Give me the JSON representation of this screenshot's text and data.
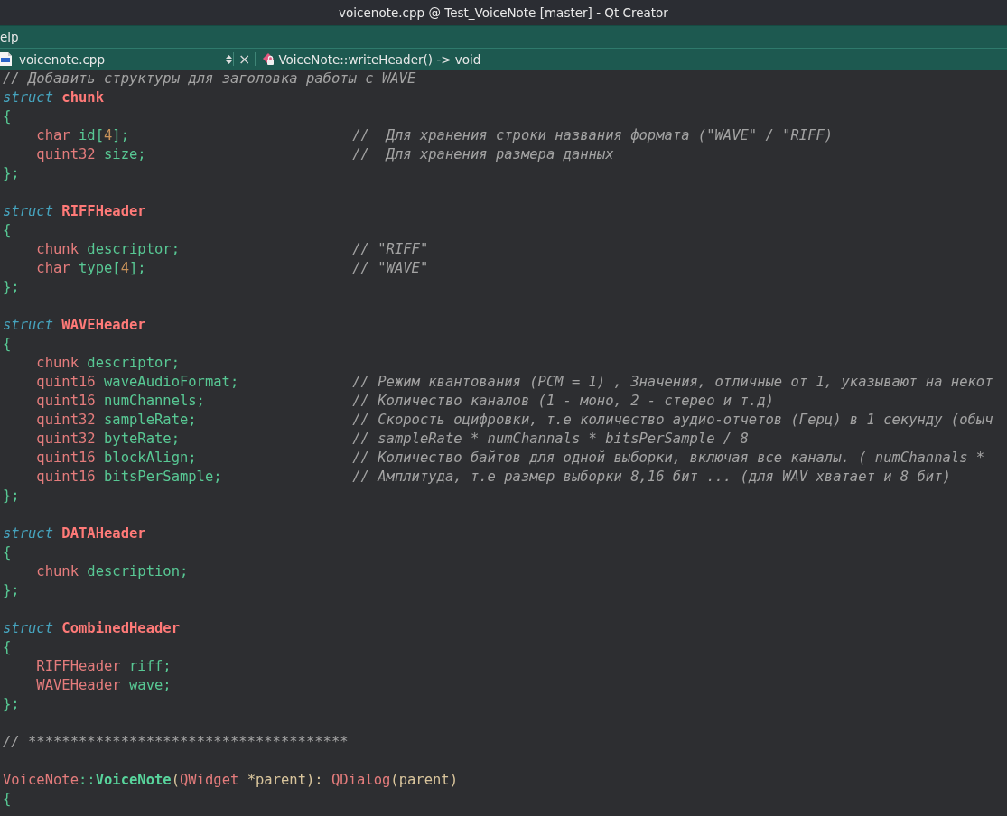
{
  "window": {
    "title": "voicenote.cpp @ Test_VoiceNote [master] - Qt Creator"
  },
  "menu_bar": {
    "items": [
      {
        "label": "elp"
      }
    ]
  },
  "editor_toolbar": {
    "file_name": "voicenote.cpp",
    "close_label": "×",
    "function_name": "VoiceNote::writeHeader() -> void"
  },
  "code_lines": [
    {
      "kind": "code",
      "indented": false,
      "tokens": [
        {
          "kind": "comment",
          "text": "// Добавить структуры для заголовка работы с WAVE"
        }
      ]
    },
    {
      "kind": "code",
      "indented": false,
      "tokens": [
        {
          "kind": "keyword",
          "text": "struct"
        },
        {
          "kind": "struct_name",
          "text": " chunk"
        }
      ]
    },
    {
      "kind": "code",
      "indented": false,
      "tokens": [
        {
          "kind": "plain",
          "text": "{"
        }
      ]
    },
    {
      "kind": "code",
      "indented": true,
      "tokens": [
        {
          "kind": "type",
          "text": "char"
        },
        {
          "kind": "plain",
          "text": " id["
        },
        {
          "kind": "number",
          "text": "4"
        },
        {
          "kind": "plain",
          "text": "];"
        }
      ],
      "comment": "//  Для хранения строки названия формата (\"WAVE\" / \"RIFF)"
    },
    {
      "kind": "code",
      "indented": true,
      "tokens": [
        {
          "kind": "type",
          "text": "quint32"
        },
        {
          "kind": "plain",
          "text": " size;"
        }
      ],
      "comment": "//  Для хранения размера данных"
    },
    {
      "kind": "code",
      "indented": false,
      "tokens": [
        {
          "kind": "plain",
          "text": "};"
        }
      ]
    },
    {
      "kind": "blank"
    },
    {
      "kind": "code",
      "indented": false,
      "tokens": [
        {
          "kind": "keyword",
          "text": "struct"
        },
        {
          "kind": "struct_name",
          "text": " RIFFHeader"
        }
      ]
    },
    {
      "kind": "code",
      "indented": false,
      "tokens": [
        {
          "kind": "plain",
          "text": "{"
        }
      ]
    },
    {
      "kind": "code",
      "indented": true,
      "tokens": [
        {
          "kind": "type",
          "text": "chunk"
        },
        {
          "kind": "plain",
          "text": " descriptor;"
        }
      ],
      "comment": "// \"RIFF\""
    },
    {
      "kind": "code",
      "indented": true,
      "tokens": [
        {
          "kind": "type",
          "text": "char"
        },
        {
          "kind": "plain",
          "text": " type["
        },
        {
          "kind": "number",
          "text": "4"
        },
        {
          "kind": "plain",
          "text": "];"
        }
      ],
      "comment": "// \"WAVE\""
    },
    {
      "kind": "code",
      "indented": false,
      "tokens": [
        {
          "kind": "plain",
          "text": "};"
        }
      ]
    },
    {
      "kind": "blank"
    },
    {
      "kind": "code",
      "indented": false,
      "tokens": [
        {
          "kind": "keyword",
          "text": "struct"
        },
        {
          "kind": "struct_name",
          "text": " WAVEHeader"
        }
      ]
    },
    {
      "kind": "code",
      "indented": false,
      "tokens": [
        {
          "kind": "plain",
          "text": "{"
        }
      ]
    },
    {
      "kind": "code",
      "indented": true,
      "tokens": [
        {
          "kind": "type",
          "text": "chunk"
        },
        {
          "kind": "plain",
          "text": " descriptor;"
        }
      ]
    },
    {
      "kind": "code",
      "indented": true,
      "tokens": [
        {
          "kind": "type",
          "text": "quint16"
        },
        {
          "kind": "plain",
          "text": " waveAudioFormat;"
        }
      ],
      "comment": "// Режим квантования (PCM = 1) , Значения, отличные от 1, указывают на некот"
    },
    {
      "kind": "code",
      "indented": true,
      "tokens": [
        {
          "kind": "type",
          "text": "quint16"
        },
        {
          "kind": "plain",
          "text": " numChannels;"
        }
      ],
      "comment": "// Количество каналов (1 - моно, 2 - стерео и т.д)"
    },
    {
      "kind": "code",
      "indented": true,
      "tokens": [
        {
          "kind": "type",
          "text": "quint32"
        },
        {
          "kind": "plain",
          "text": " sampleRate;"
        }
      ],
      "comment": "// Скорость оцифровки, т.е количество аудио-отчетов (Герц) в 1 секунду (обыч"
    },
    {
      "kind": "code",
      "indented": true,
      "tokens": [
        {
          "kind": "type",
          "text": "quint32"
        },
        {
          "kind": "plain",
          "text": " byteRate;"
        }
      ],
      "comment": "// sampleRate * numChannals * bitsPerSample / 8"
    },
    {
      "kind": "code",
      "indented": true,
      "tokens": [
        {
          "kind": "type",
          "text": "quint16"
        },
        {
          "kind": "plain",
          "text": " blockAlign;"
        }
      ],
      "comment": "// Количество байтов для одной выборки, включая все каналы. ( numChannals *"
    },
    {
      "kind": "code",
      "indented": true,
      "tokens": [
        {
          "kind": "type",
          "text": "quint16"
        },
        {
          "kind": "plain",
          "text": " bitsPerSample;"
        }
      ],
      "comment": "// Амплитуда, т.е размер выборки 8,16 бит ... (для WAV хватает и 8 бит)"
    },
    {
      "kind": "code",
      "indented": false,
      "tokens": [
        {
          "kind": "plain",
          "text": "};"
        }
      ]
    },
    {
      "kind": "blank"
    },
    {
      "kind": "code",
      "indented": false,
      "tokens": [
        {
          "kind": "keyword",
          "text": "struct"
        },
        {
          "kind": "struct_name",
          "text": " DATAHeader"
        }
      ]
    },
    {
      "kind": "code",
      "indented": false,
      "tokens": [
        {
          "kind": "plain",
          "text": "{"
        }
      ]
    },
    {
      "kind": "code",
      "indented": true,
      "tokens": [
        {
          "kind": "type",
          "text": "chunk"
        },
        {
          "kind": "plain",
          "text": " description;"
        }
      ]
    },
    {
      "kind": "code",
      "indented": false,
      "tokens": [
        {
          "kind": "plain",
          "text": "};"
        }
      ]
    },
    {
      "kind": "blank"
    },
    {
      "kind": "code",
      "indented": false,
      "tokens": [
        {
          "kind": "keyword",
          "text": "struct"
        },
        {
          "kind": "struct_name",
          "text": " CombinedHeader"
        }
      ]
    },
    {
      "kind": "code",
      "indented": false,
      "tokens": [
        {
          "kind": "plain",
          "text": "{"
        }
      ]
    },
    {
      "kind": "code",
      "indented": true,
      "tokens": [
        {
          "kind": "type",
          "text": "RIFFHeader"
        },
        {
          "kind": "plain",
          "text": " riff;"
        }
      ]
    },
    {
      "kind": "code",
      "indented": true,
      "tokens": [
        {
          "kind": "type",
          "text": "WAVEHeader"
        },
        {
          "kind": "plain",
          "text": " wave;"
        }
      ]
    },
    {
      "kind": "code",
      "indented": false,
      "tokens": [
        {
          "kind": "plain",
          "text": "};"
        }
      ]
    },
    {
      "kind": "blank"
    },
    {
      "kind": "code",
      "indented": false,
      "tokens": [
        {
          "kind": "comment",
          "text": "// **************************************"
        }
      ]
    },
    {
      "kind": "blank"
    },
    {
      "kind": "code",
      "indented": false,
      "tokens": [
        {
          "kind": "type",
          "text": "VoiceNote"
        },
        {
          "kind": "plain",
          "text": "::"
        },
        {
          "kind": "function",
          "text": "VoiceNote"
        },
        {
          "kind": "param",
          "text": "("
        },
        {
          "kind": "type",
          "text": "QWidget"
        },
        {
          "kind": "param",
          "text": " *parent): "
        },
        {
          "kind": "type",
          "text": "QDialog"
        },
        {
          "kind": "param",
          "text": "(parent)"
        }
      ]
    },
    {
      "kind": "code",
      "indented": false,
      "tokens": [
        {
          "kind": "plain",
          "text": "{"
        }
      ]
    }
  ]
}
